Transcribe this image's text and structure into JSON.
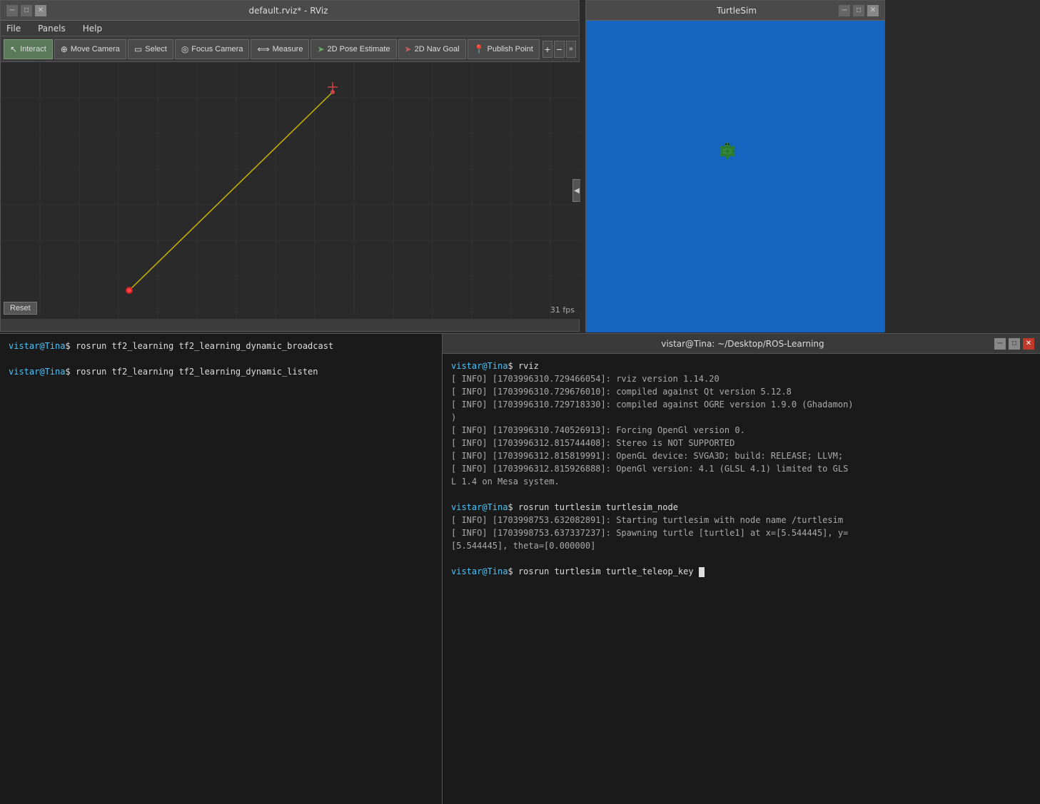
{
  "rviz": {
    "title": "default.rviz* - RViz",
    "menu": {
      "file": "File",
      "panels": "Panels",
      "help": "Help"
    },
    "toolbar": {
      "interact": "Interact",
      "move_camera": "Move Camera",
      "select": "Select",
      "focus_camera": "Focus Camera",
      "measure": "Measure",
      "pose_estimate": "2D Pose Estimate",
      "nav_goal": "2D Nav Goal",
      "publish_point": "Publish Point"
    },
    "fps": "31 fps",
    "reset": "Reset"
  },
  "turtlesim": {
    "title": "TurtleSim"
  },
  "terminal_shared": {
    "title": "vistar@Tina: ~/Desktop/ROS-Learning"
  },
  "terminal_left": {
    "cmd1": "rosrun tf2_learning tf2_learning_dynamic_broadcast",
    "cmd2": "rosrun tf2_learning tf2_learning_dynamic_listen"
  },
  "terminal_right": {
    "cmd_rviz": "rviz",
    "info1": "[ INFO] [1703996310.729466054]: rviz version 1.14.20",
    "info2": "[ INFO] [1703996310.729676010]: compiled against Qt version 5.12.8",
    "info3": "[ INFO] [1703996310.729718330]: compiled against OGRE version 1.9.0 (Ghadamon)",
    "info3b": ")",
    "info4": "[ INFO] [1703996310.740526913]: Forcing OpenGl version 0.",
    "info5": "[ INFO] [1703996312.815744408]: Stereo is NOT SUPPORTED",
    "info6": "[ INFO] [1703996312.815819991]: OpenGL device: SVGA3D; build: RELEASE;  LLVM;",
    "info7": "[ INFO] [1703996312.815926888]: OpenGl version: 4.1 (GLSL 4.1) limited to GLS",
    "info7b": "L 1.4 on Mesa system.",
    "cmd_turtlesim": "rosrun turtlesim turtlesim_node",
    "tinfo1": "[ INFO] [1703998753.632082891]: Starting turtlesim with node name /turtlesim",
    "tinfo2": "[ INFO] [1703998753.637337237]: Spawning turtle [turtle1] at x=[5.544445], y=",
    "tinfo2b": "[5.544445], theta=[0.000000]",
    "cmd_teleop": "rosrun turtlesim turtle_teleop_key"
  }
}
